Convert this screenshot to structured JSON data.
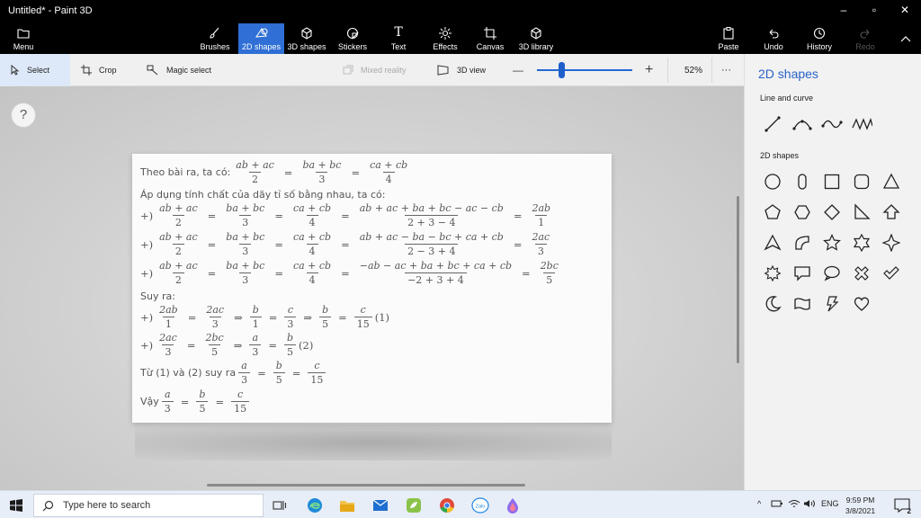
{
  "window": {
    "title": "Untitled* - Paint 3D"
  },
  "ribbon": {
    "menu": "Menu",
    "tools": [
      {
        "label": "Brushes",
        "icon": "brush-icon"
      },
      {
        "label": "2D shapes",
        "icon": "2d-shapes-icon"
      },
      {
        "label": "3D shapes",
        "icon": "3d-shapes-icon"
      },
      {
        "label": "Stickers",
        "icon": "stickers-icon"
      },
      {
        "label": "Text",
        "icon": "text-icon"
      },
      {
        "label": "Effects",
        "icon": "effects-icon"
      },
      {
        "label": "Canvas",
        "icon": "canvas-icon"
      },
      {
        "label": "3D library",
        "icon": "3d-library-icon"
      }
    ],
    "paste": "Paste",
    "undo": "Undo",
    "history": "History",
    "redo": "Redo",
    "active_tool": "2D shapes"
  },
  "toolbar": {
    "select": "Select",
    "crop": "Crop",
    "magic_select": "Magic select",
    "mixed_reality": "Mixed reality",
    "view_3d": "3D view",
    "zoom": "52%",
    "zoom_minus": "—",
    "zoom_plus": "+",
    "more": "···"
  },
  "canvas": {
    "help": "?",
    "math": {
      "l1_text": "Theo bài ra, ta có:",
      "l2_text": "Áp dụng tính chất của dãy tỉ số bằng nhau, ta có:",
      "plus": "+)",
      "ab_ac": "ab + ac",
      "ba_bc": "ba + bc",
      "ca_cb": "ca + cb",
      "n2": "2",
      "n3": "3",
      "n4": "4",
      "n5": "5",
      "n1": "1",
      "eq": "=",
      "r1_num": "ab + ac + ba + bc − ac − cb",
      "r1_den": "2 + 3 − 4",
      "r1_res_num": "2ab",
      "r2_num": "ab + ac − ba − bc + ca + cb",
      "r2_den": "2 − 3 + 4",
      "r2_res_num": "2ac",
      "r3_num": "−ab − ac + ba + bc + ca + cb",
      "r3_den": "−2 + 3 + 4",
      "r3_res_num": "2bc",
      "suy_ra": "Suy ra:",
      "imp": "⇒",
      "a": "a",
      "b": "b",
      "c": "c",
      "c15": "15",
      "mark1": "(1)",
      "mark2": "(2)",
      "tu_text": "Từ (1) và (2) suy ra",
      "vay_text": "Vậy"
    }
  },
  "panel": {
    "title": "2D shapes",
    "line_section": "Line and curve",
    "shapes_section": "2D shapes"
  },
  "taskbar": {
    "search_placeholder": "Type here to search",
    "language": "ENG",
    "time": "9:59 PM",
    "date": "3/8/2021",
    "notification_count": "2"
  },
  "colors": {
    "accent": "#2f6fd6",
    "ribbon": "#000000",
    "panel": "#f2f2f2"
  }
}
